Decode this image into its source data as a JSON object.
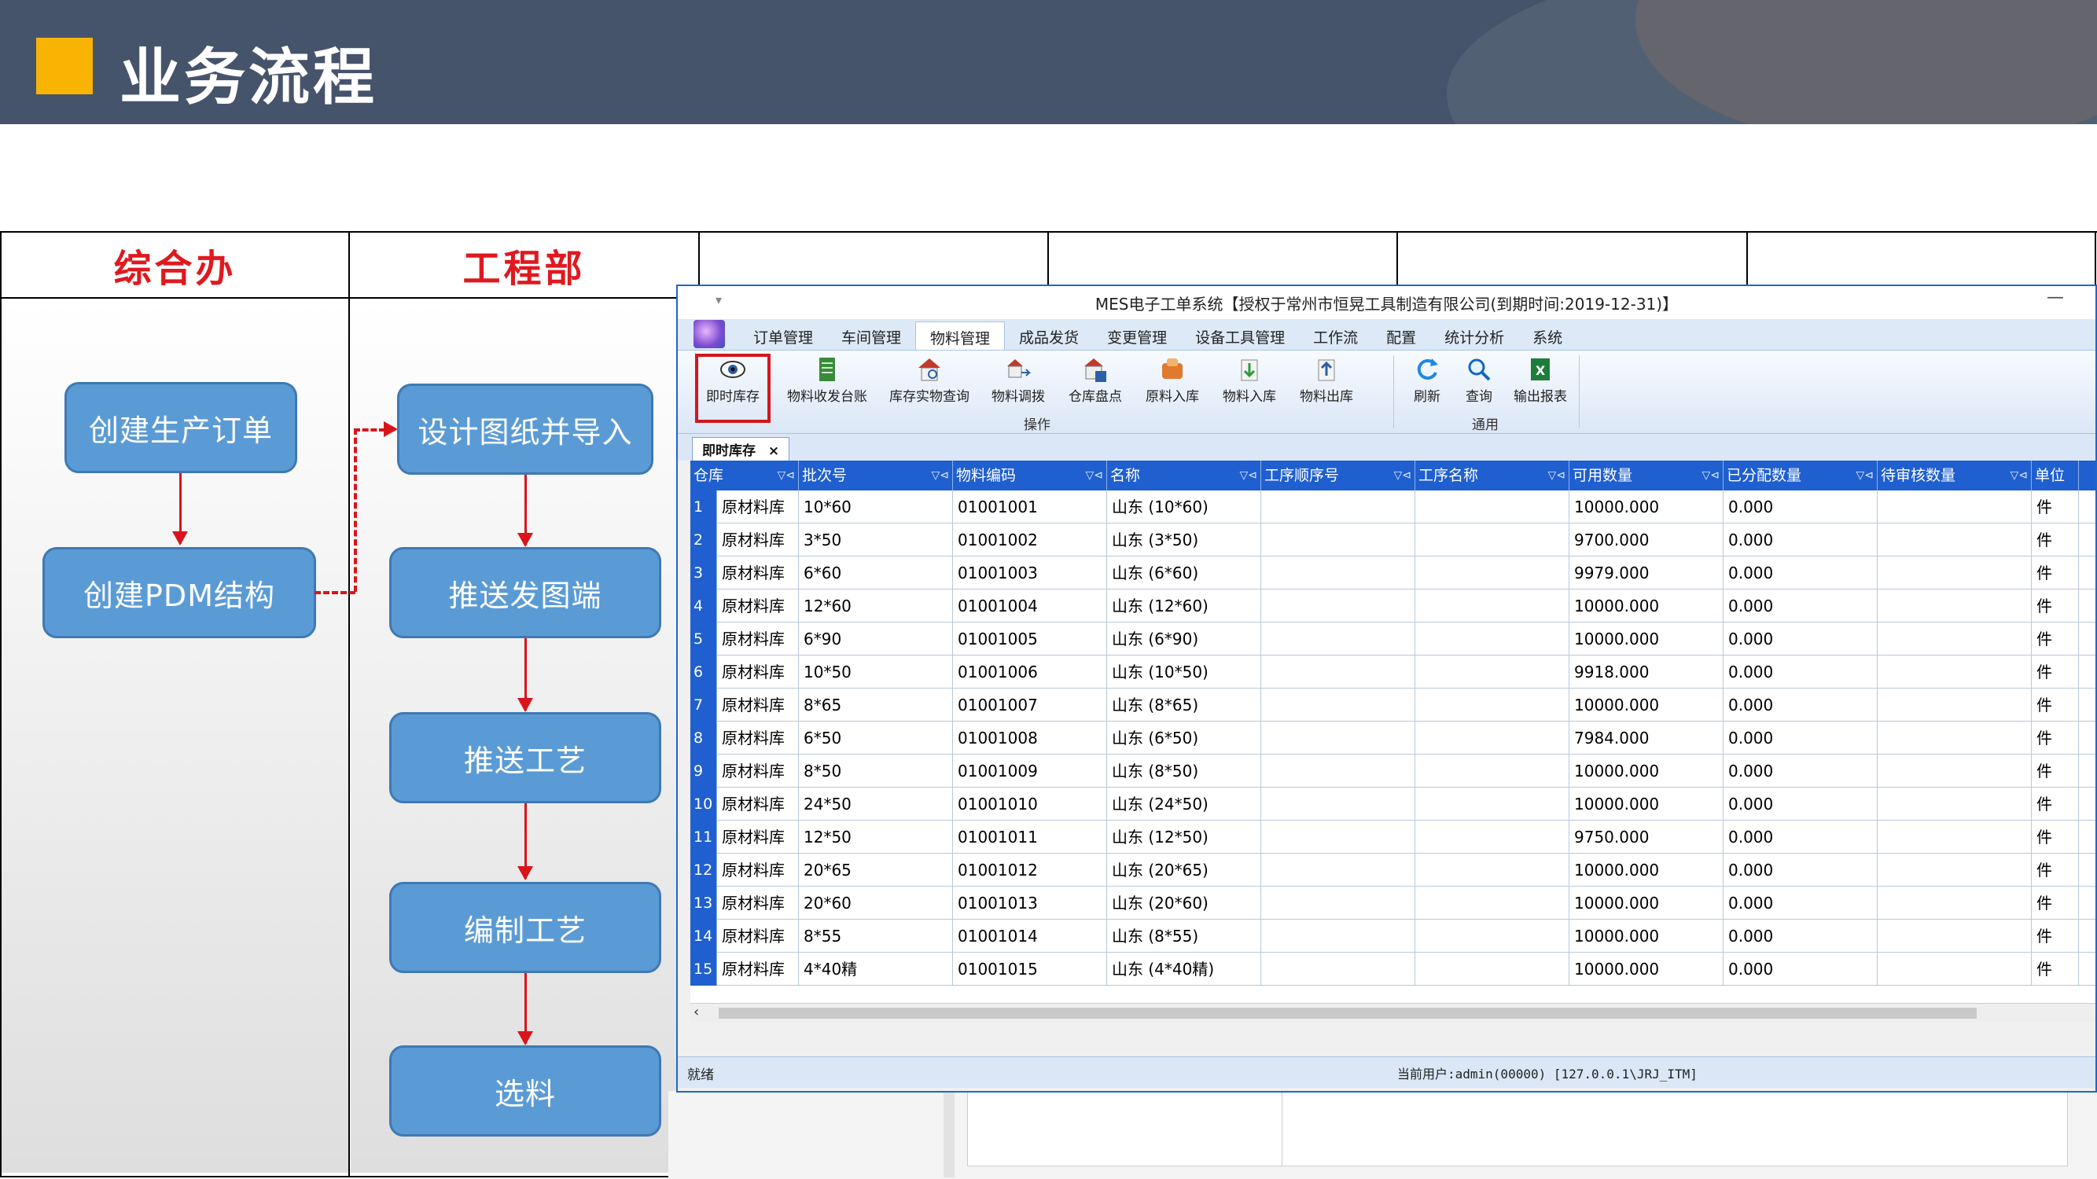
{
  "slide": {
    "title": "业务流程"
  },
  "lanes": {
    "headers": [
      "综合办",
      "工程部",
      "",
      "",
      "",
      ""
    ]
  },
  "flow": {
    "office": [
      "创建生产订单",
      "创建PDM结构"
    ],
    "engineering": [
      "设计图纸并导入",
      "推送发图端",
      "推送工艺",
      "编制工艺",
      "选料"
    ]
  },
  "window": {
    "title": "MES电子工单系统【授权于常州市恒晃工具制造有限公司(到期时间:2019-12-31)】",
    "minimize": "—",
    "quick_access": "▾",
    "menu": [
      "订单管理",
      "车间管理",
      "物料管理",
      "成品发货",
      "变更管理",
      "设备工具管理",
      "工作流",
      "配置",
      "统计分析",
      "系统"
    ],
    "active_menu": "物料管理",
    "ribbon": {
      "operate_group": "操作",
      "common_group": "通用",
      "buttons": [
        {
          "label": "即时库存",
          "icon": "eye-icon"
        },
        {
          "label": "物料收发台账",
          "icon": "ledger-icon"
        },
        {
          "label": "库存实物查询",
          "icon": "warehouse-search-icon"
        },
        {
          "label": "物料调拨",
          "icon": "transfer-icon"
        },
        {
          "label": "仓库盘点",
          "icon": "inventory-check-icon"
        },
        {
          "label": "原料入库",
          "icon": "raw-inbound-icon"
        },
        {
          "label": "物料入库",
          "icon": "material-inbound-icon"
        },
        {
          "label": "物料出库",
          "icon": "material-outbound-icon"
        }
      ],
      "common_buttons": [
        {
          "label": "刷新",
          "icon": "refresh-icon"
        },
        {
          "label": "查询",
          "icon": "search-icon"
        },
        {
          "label": "输出报表",
          "icon": "excel-export-icon"
        }
      ]
    },
    "doc_tab": {
      "label": "即时库存",
      "close": "×"
    },
    "grid": {
      "columns": [
        "仓库",
        "批次号",
        "物料编码",
        "名称",
        "工序顺序号",
        "工序名称",
        "可用数量",
        "已分配数量",
        "待审核数量",
        "单位"
      ],
      "rows": [
        {
          "n": "1",
          "wh": "原材料库",
          "batch": "10*60",
          "code": "01001001",
          "name": "山东 (10*60)",
          "seq": "",
          "proc": "",
          "avail": "10000.000",
          "alloc": "0.000",
          "pending": "",
          "unit": "件"
        },
        {
          "n": "2",
          "wh": "原材料库",
          "batch": "3*50",
          "code": "01001002",
          "name": "山东 (3*50)",
          "seq": "",
          "proc": "",
          "avail": "9700.000",
          "alloc": "0.000",
          "pending": "",
          "unit": "件"
        },
        {
          "n": "3",
          "wh": "原材料库",
          "batch": "6*60",
          "code": "01001003",
          "name": "山东 (6*60)",
          "seq": "",
          "proc": "",
          "avail": "9979.000",
          "alloc": "0.000",
          "pending": "",
          "unit": "件"
        },
        {
          "n": "4",
          "wh": "原材料库",
          "batch": "12*60",
          "code": "01001004",
          "name": "山东 (12*60)",
          "seq": "",
          "proc": "",
          "avail": "10000.000",
          "alloc": "0.000",
          "pending": "",
          "unit": "件"
        },
        {
          "n": "5",
          "wh": "原材料库",
          "batch": "6*90",
          "code": "01001005",
          "name": "山东 (6*90)",
          "seq": "",
          "proc": "",
          "avail": "10000.000",
          "alloc": "0.000",
          "pending": "",
          "unit": "件"
        },
        {
          "n": "6",
          "wh": "原材料库",
          "batch": "10*50",
          "code": "01001006",
          "name": "山东 (10*50)",
          "seq": "",
          "proc": "",
          "avail": "9918.000",
          "alloc": "0.000",
          "pending": "",
          "unit": "件"
        },
        {
          "n": "7",
          "wh": "原材料库",
          "batch": "8*65",
          "code": "01001007",
          "name": "山东 (8*65)",
          "seq": "",
          "proc": "",
          "avail": "10000.000",
          "alloc": "0.000",
          "pending": "",
          "unit": "件"
        },
        {
          "n": "8",
          "wh": "原材料库",
          "batch": "6*50",
          "code": "01001008",
          "name": "山东 (6*50)",
          "seq": "",
          "proc": "",
          "avail": "7984.000",
          "alloc": "0.000",
          "pending": "",
          "unit": "件"
        },
        {
          "n": "9",
          "wh": "原材料库",
          "batch": "8*50",
          "code": "01001009",
          "name": "山东 (8*50)",
          "seq": "",
          "proc": "",
          "avail": "10000.000",
          "alloc": "0.000",
          "pending": "",
          "unit": "件"
        },
        {
          "n": "10",
          "wh": "原材料库",
          "batch": "24*50",
          "code": "01001010",
          "name": "山东 (24*50)",
          "seq": "",
          "proc": "",
          "avail": "10000.000",
          "alloc": "0.000",
          "pending": "",
          "unit": "件"
        },
        {
          "n": "11",
          "wh": "原材料库",
          "batch": "12*50",
          "code": "01001011",
          "name": "山东 (12*50)",
          "seq": "",
          "proc": "",
          "avail": "9750.000",
          "alloc": "0.000",
          "pending": "",
          "unit": "件"
        },
        {
          "n": "12",
          "wh": "原材料库",
          "batch": "20*65",
          "code": "01001012",
          "name": "山东 (20*65)",
          "seq": "",
          "proc": "",
          "avail": "10000.000",
          "alloc": "0.000",
          "pending": "",
          "unit": "件"
        },
        {
          "n": "13",
          "wh": "原材料库",
          "batch": "20*60",
          "code": "01001013",
          "name": "山东 (20*60)",
          "seq": "",
          "proc": "",
          "avail": "10000.000",
          "alloc": "0.000",
          "pending": "",
          "unit": "件"
        },
        {
          "n": "14",
          "wh": "原材料库",
          "batch": "8*55",
          "code": "01001014",
          "name": "山东 (8*55)",
          "seq": "",
          "proc": "",
          "avail": "10000.000",
          "alloc": "0.000",
          "pending": "",
          "unit": "件"
        },
        {
          "n": "15",
          "wh": "原材料库",
          "batch": "4*40精",
          "code": "01001015",
          "name": "山东 (4*40精)",
          "seq": "",
          "proc": "",
          "avail": "10000.000",
          "alloc": "0.000",
          "pending": "",
          "unit": "件"
        }
      ]
    },
    "status": {
      "left": "就绪",
      "user": "当前用户:admin(00000) [127.0.0.1\\JRJ_ITM]"
    }
  },
  "colors": {
    "banner": "#46546b",
    "accent": "#f9b403",
    "lane_header": "#e0191f",
    "flow_box": "#5b9bd5",
    "grid_header": "#1f5fcf",
    "highlight": "#d4161e"
  }
}
